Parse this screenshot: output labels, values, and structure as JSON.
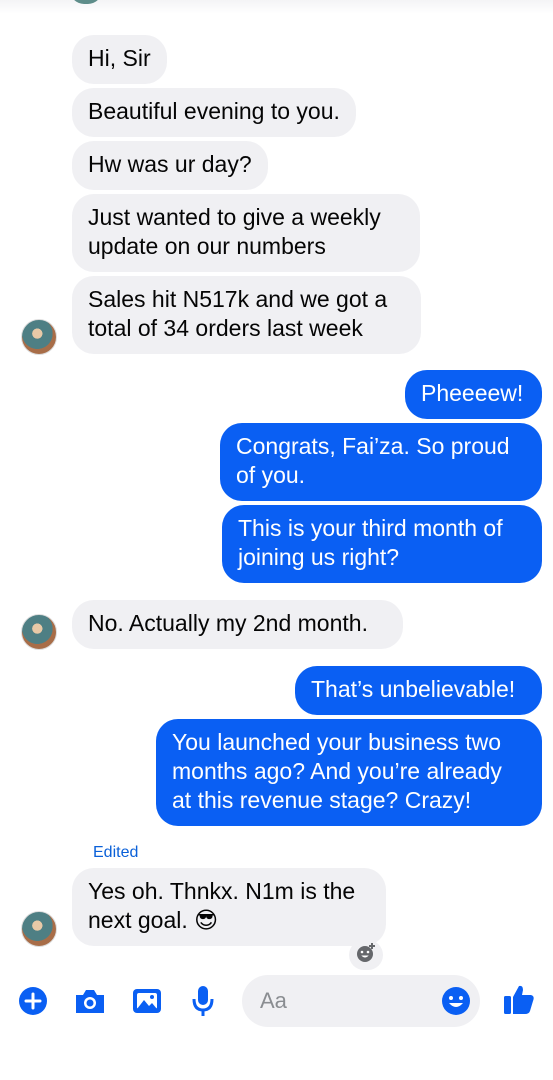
{
  "colors": {
    "accent": "#0a5ff3",
    "incoming_bubble": "#f0f0f3",
    "edited_label": "#0a60d8"
  },
  "messages": [
    {
      "direction": "incoming",
      "text": "Hi, Sir"
    },
    {
      "direction": "incoming",
      "text": "Beautiful evening to you."
    },
    {
      "direction": "incoming",
      "text": "Hw was ur day?"
    },
    {
      "direction": "incoming",
      "text": "Just wanted to give a weekly\nupdate on our numbers"
    },
    {
      "direction": "incoming",
      "text": "Sales hit N517k and we got a\ntotal of 34 orders last week"
    },
    {
      "direction": "outgoing",
      "text": "Pheeeew!"
    },
    {
      "direction": "outgoing",
      "text": "Congrats, Fai’za. So proud\nof you."
    },
    {
      "direction": "outgoing",
      "text": "This is your third month of\njoining us right?"
    },
    {
      "direction": "incoming",
      "text": "No. Actually my 2nd month."
    },
    {
      "direction": "outgoing",
      "text": "That’s unbelievable!"
    },
    {
      "direction": "outgoing",
      "text": "You launched your business two\nmonths ago? And you’re already\nat this revenue stage? Crazy!"
    },
    {
      "direction": "incoming",
      "text": "Yes oh. Thnkx. N1m is the\nnext goal. 😎",
      "edited_label": "Edited"
    }
  ],
  "composer": {
    "placeholder": "Aa",
    "icons": [
      "plus-icon",
      "camera-icon",
      "gallery-icon",
      "microphone-icon",
      "emoji-icon",
      "thumbs-up-icon"
    ]
  }
}
